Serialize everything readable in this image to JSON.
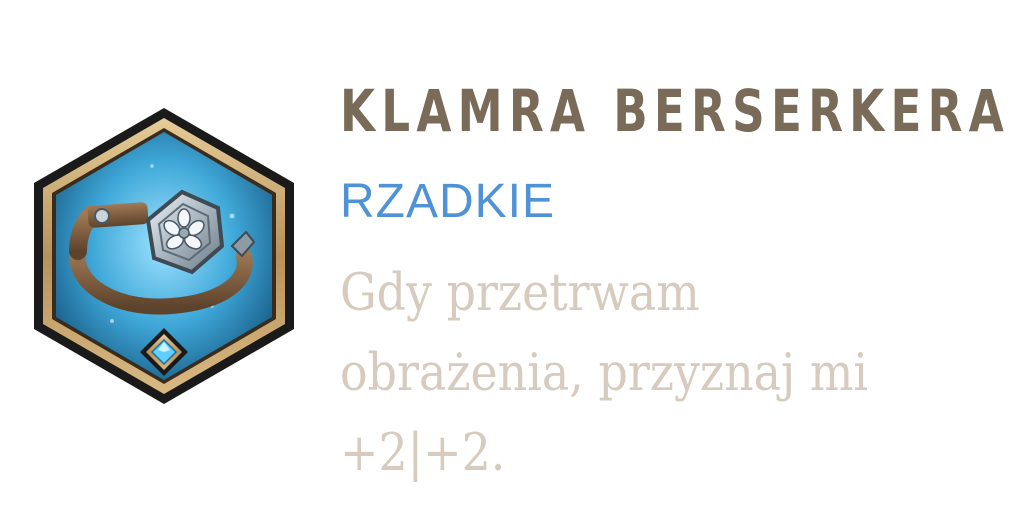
{
  "item": {
    "name": "KLAMRA BERSERKERA",
    "rarity": "RZADKIE",
    "description_lines": [
      "Gdy przetrwam",
      "obrażenia, przyznaj mi",
      "+2|+2."
    ],
    "icon": "belt-buckle-icon"
  },
  "colors": {
    "title": "#7a6a58",
    "rarity": "#4f93d6",
    "description": "#d6cbbd",
    "frame_outer": "#1a1a1a",
    "frame_gold": "#c8a774",
    "background_blue": "#3fa8d8",
    "gem_blue": "#5fd0ff"
  }
}
